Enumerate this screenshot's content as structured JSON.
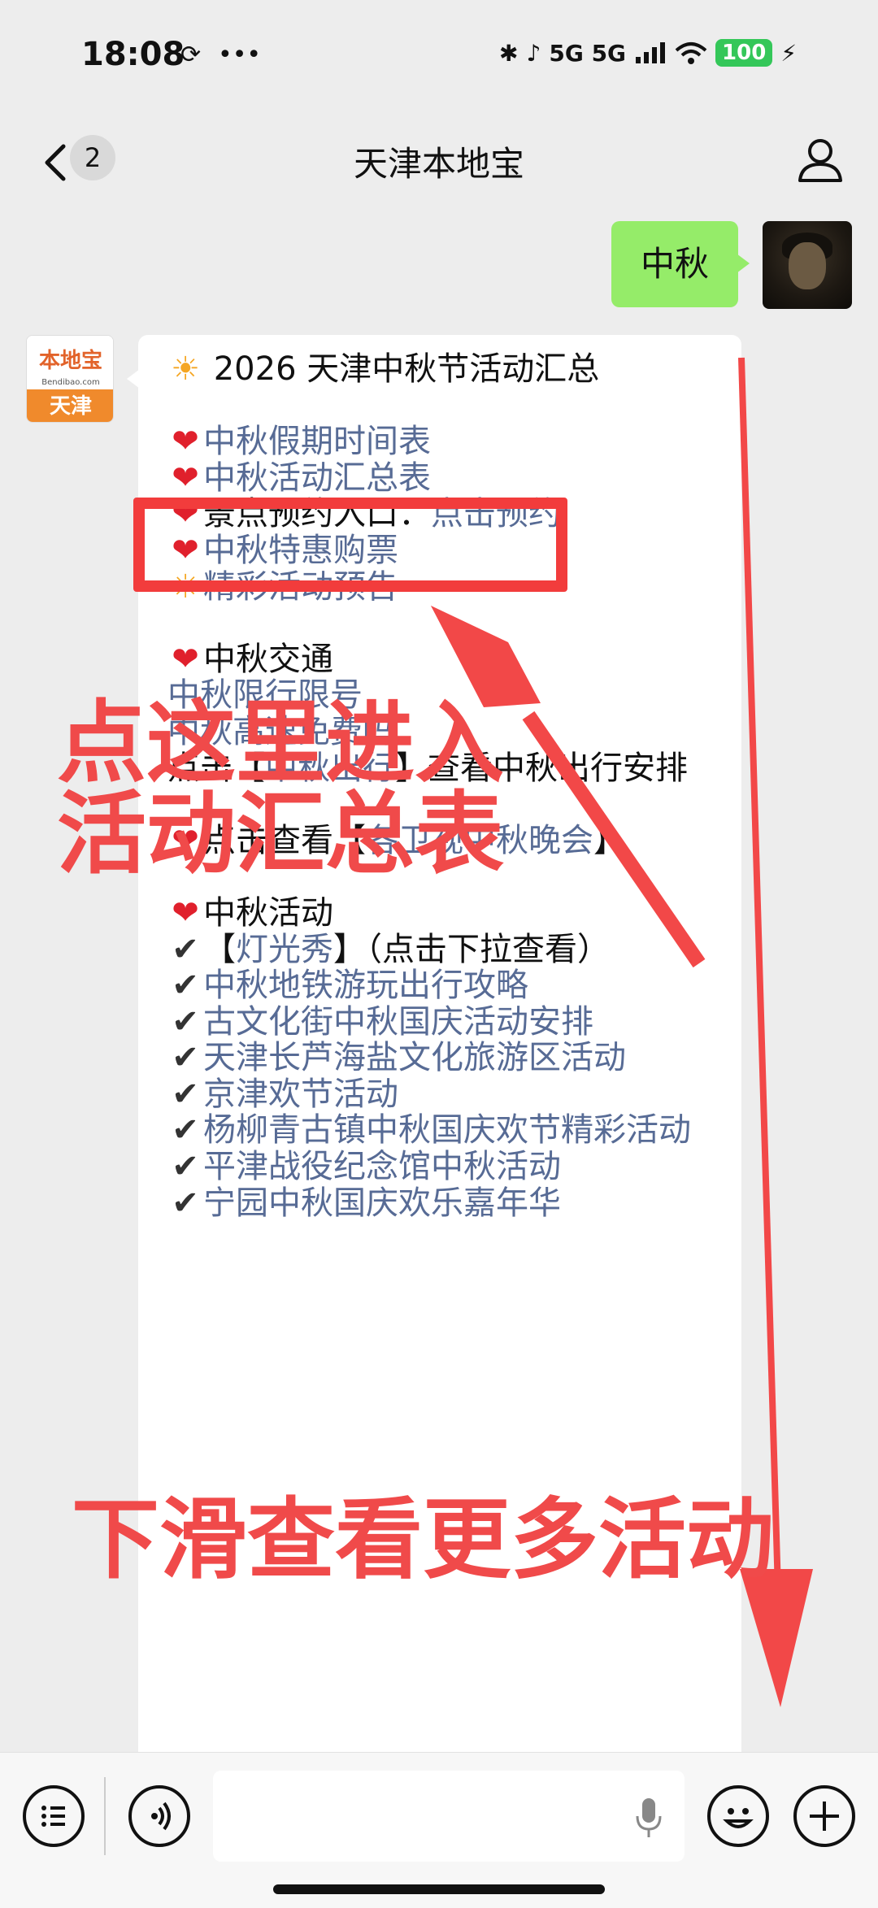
{
  "status_bar": {
    "time": "18:08",
    "extra": "•••",
    "signal": "5G 5G",
    "battery": "100"
  },
  "nav": {
    "back_label": "‹",
    "unread_count": "2",
    "title": "天津本地宝"
  },
  "chat": {
    "sent_message": "中秋",
    "oa_avatar": {
      "top": "本地宝",
      "mid": "Bendibao.com",
      "bottom": "天津"
    },
    "reply": {
      "title": "2026 天津中秋节活动汇总",
      "lines": [
        {
          "emoji": "❤️",
          "text": "中秋假期时间表",
          "link": true
        },
        {
          "emoji": "❤️",
          "text": "中秋活动汇总表",
          "link": true
        },
        {
          "emoji": "❤️",
          "prefix": "景点预约入口：",
          "text": "点击预约",
          "link": true
        },
        {
          "emoji": "❤️",
          "text": "中秋特惠购票",
          "link": true
        },
        {
          "emoji": "☀️",
          "text": "精彩活动预告",
          "link": true
        }
      ],
      "traffic_header": "中秋交通",
      "traffic_links": [
        "中秋限行限号",
        "中秋高速免费吗"
      ],
      "travel_prefix": "点击【",
      "travel_link": "中秋出行",
      "travel_suffix": "】查看中秋出行安排",
      "gala_prefix": "点击查看【",
      "gala_link": "各卫视中秋晚会",
      "gala_suffix": "】",
      "activity_header": "中秋活动",
      "light_prefix": "【",
      "light_link": "灯光秀",
      "light_suffix": "】（点击下拉查看）",
      "activities": [
        "中秋地铁游玩出行攻略",
        "古文化街中秋国庆活动安排",
        "天津长芦海盐文化旅游区活动",
        "京津欢节活动",
        "杨柳青古镇中秋国庆欢节精彩活动",
        "平津战役纪念馆中秋活动",
        "宁园中秋国庆欢乐嘉年华"
      ]
    }
  },
  "annotations": {
    "tap_here": "点这里进入\n活动汇总表",
    "scroll_more": "下滑查看更多活动"
  },
  "icons": {
    "back": "chevron-left-icon",
    "profile": "person-icon",
    "menu": "list-icon",
    "voice": "voice-icon",
    "mic": "microphone-icon",
    "emoji": "smiley-icon",
    "add": "plus-icon"
  },
  "colors": {
    "link": "#576b95",
    "sent_bubble": "#95ec69",
    "annotation_red": "#f04a4a",
    "battery": "#34c759"
  }
}
